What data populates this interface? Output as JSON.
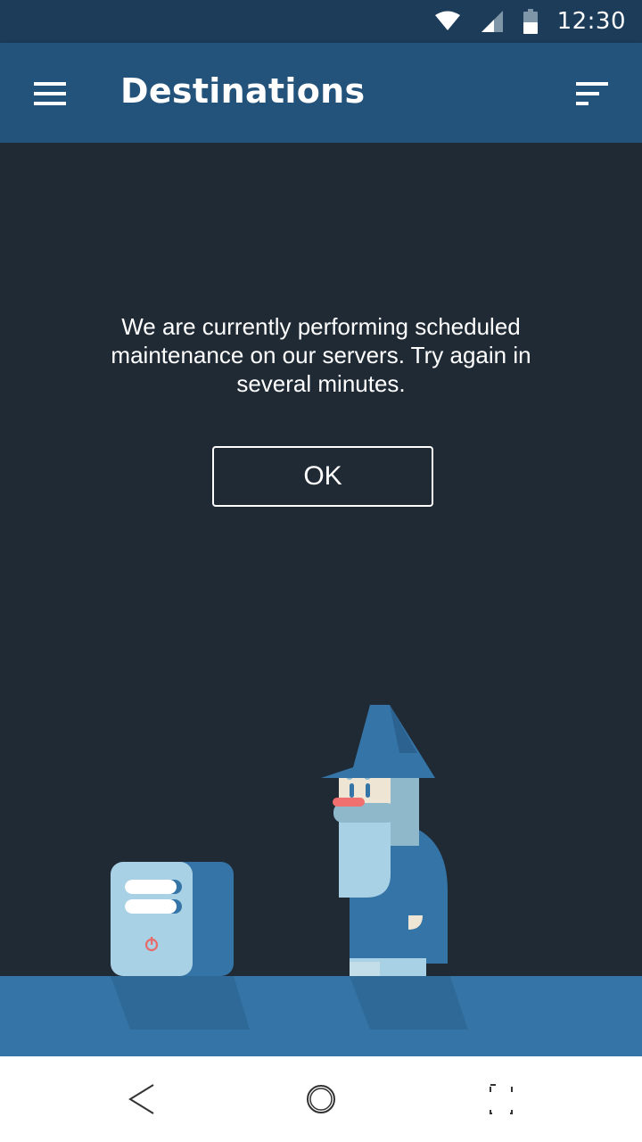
{
  "status_bar": {
    "time": "12:30",
    "icons": [
      "wifi-icon",
      "signal-icon",
      "battery-icon"
    ]
  },
  "app_bar": {
    "title": "Destinations",
    "menu_icon": "menu-icon",
    "sort_icon": "sort-icon"
  },
  "dialog": {
    "message": "We are currently performing scheduled maintenance on our servers. Try again in several minutes.",
    "ok_label": "OK"
  },
  "nav_bar": {
    "icons": [
      "back-icon",
      "home-icon",
      "recents-icon"
    ]
  },
  "colors": {
    "status_bar": "#1c3c5a",
    "app_bar": "#23537b",
    "background": "#1f2a35",
    "ground": "#3574a6"
  }
}
